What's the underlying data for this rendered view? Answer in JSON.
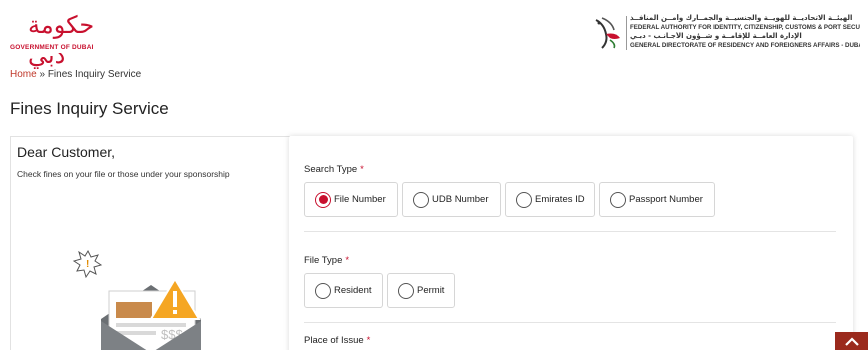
{
  "header": {
    "gov_logo_arabic": "حكومة دبي",
    "gov_logo_text": "GOVERNMENT OF DUBAI",
    "authority_lines": [
      "الهيئــة الاتحاديــة للهويــة والجنسيــة والجمــارك وأمــن المنافــذ",
      "FEDERAL AUTHORITY FOR IDENTITY, CITIZENSHIP, CUSTOMS & PORT SECURITY",
      "الإدارة العامــة للإقامــة و شــؤون الأجـانـب - دبـي",
      "GENERAL DIRECTORATE OF RESIDENCY AND FOREIGNERS AFFAIRS - DUBAI"
    ]
  },
  "breadcrumb": {
    "home": "Home",
    "separator": " » ",
    "current": "Fines Inquiry Service"
  },
  "page_title": "Fines Inquiry Service",
  "intro": {
    "greeting": "Dear Customer,",
    "description": "Check fines on your file or those under your sponsorship"
  },
  "form": {
    "search_type": {
      "label": "Search Type",
      "required_mark": "*",
      "options": [
        "File Number",
        "UDB Number",
        "Emirates ID",
        "Passport Number"
      ],
      "selected": "File Number"
    },
    "file_type": {
      "label": "File Type",
      "required_mark": "*",
      "options": [
        "Resident",
        "Permit"
      ],
      "selected": null
    },
    "place_of_issue": {
      "label": "Place of Issue",
      "required_mark": "*"
    }
  },
  "colors": {
    "accent": "#c8102e",
    "scroll_button": "#9b2a1d"
  },
  "icons": {
    "scroll_top": "chevron-up-icon",
    "illustration": "fines-envelope-illustration",
    "warning": "warning-triangle-icon"
  },
  "illustration_text": {
    "amount": "$$$"
  }
}
